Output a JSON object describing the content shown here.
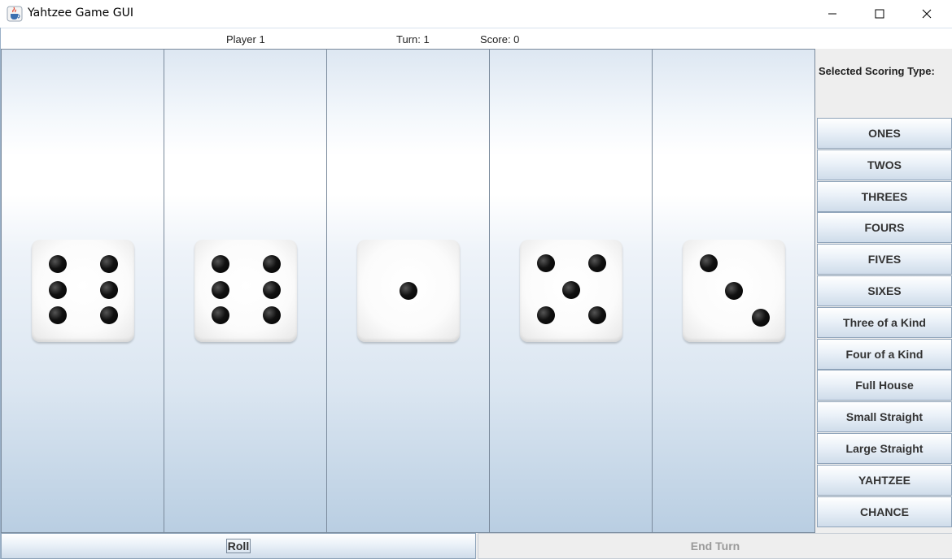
{
  "window": {
    "title": "Yahtzee Game GUI",
    "app_icon": "java-cup-icon",
    "controls": [
      "minimize-icon",
      "maximize-icon",
      "close-icon"
    ]
  },
  "status": {
    "player": "Player 1",
    "turn": "Turn: 1",
    "score": "Score: 0"
  },
  "dice": [
    6,
    6,
    1,
    5,
    3
  ],
  "scoring": {
    "heading": "Selected Scoring Type:",
    "options": [
      "ONES",
      "TWOS",
      "THREES",
      "FOURS",
      "FIVES",
      "SIXES",
      "Three of a Kind",
      "Four of a Kind",
      "Full House",
      "Small Straight",
      "Large Straight",
      "YAHTZEE",
      "CHANCE"
    ]
  },
  "actions": {
    "roll": "Roll",
    "end_turn": "End Turn"
  },
  "colors": {
    "panel_border": "#7a8a9c",
    "button_border": "#8ea3b9",
    "disabled_text": "#9a9a9a"
  }
}
